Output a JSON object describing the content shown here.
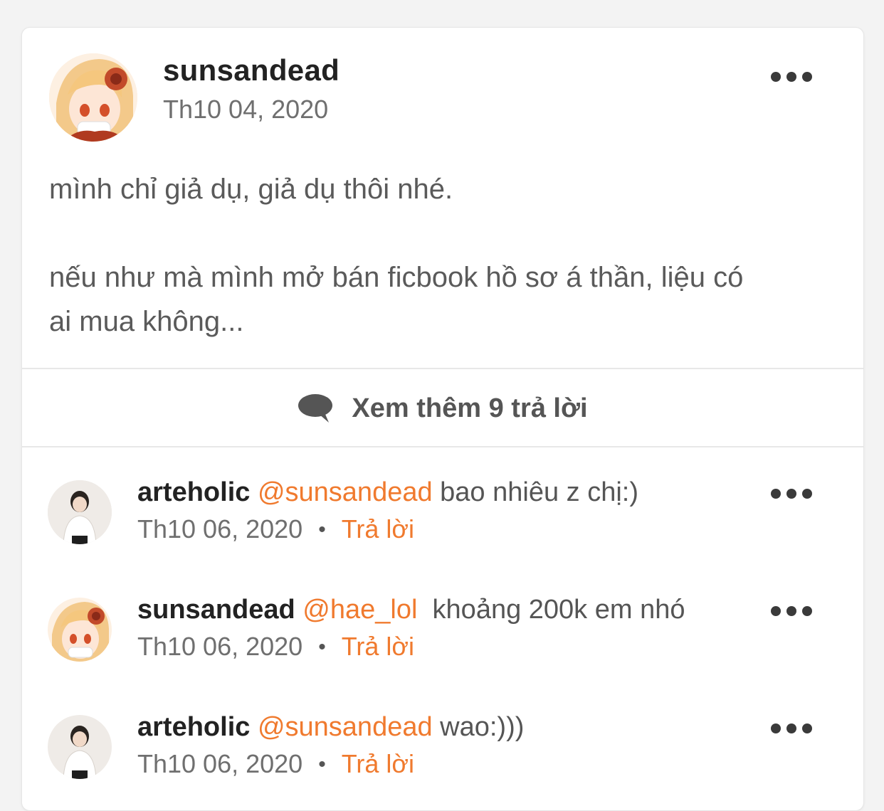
{
  "post": {
    "author": "sunsandead",
    "date": "Th10 04, 2020",
    "body_line1": "mình chỉ giả dụ, giả dụ thôi nhé.",
    "body_line2": "nếu như mà mình mở bán ficbook hồ sơ á thần, liệu có",
    "body_line3": "ai mua không..."
  },
  "more_replies": {
    "label": "Xem thêm 9 trả lời"
  },
  "replies": [
    {
      "author": "arteholic",
      "mention": "@sunsandead",
      "text": " bao nhiêu z chị:)",
      "date": "Th10 06, 2020",
      "separator": "•",
      "reply_label": "Trả lời"
    },
    {
      "author": "sunsandead",
      "mention": "@hae_lol",
      "text": "  khoảng 200k em nhó",
      "date": "Th10 06, 2020",
      "separator": "•",
      "reply_label": "Trả lời"
    },
    {
      "author": "arteholic",
      "mention": "@sunsandead",
      "text": " wao:)))",
      "date": "Th10 06, 2020",
      "separator": "•",
      "reply_label": "Trả lời"
    }
  ],
  "colors": {
    "accent": "#f07a2e",
    "text_muted": "#6f6f6f"
  },
  "icons": {
    "more": "more-horizontal-icon",
    "comment": "comment-bubble-icon"
  }
}
